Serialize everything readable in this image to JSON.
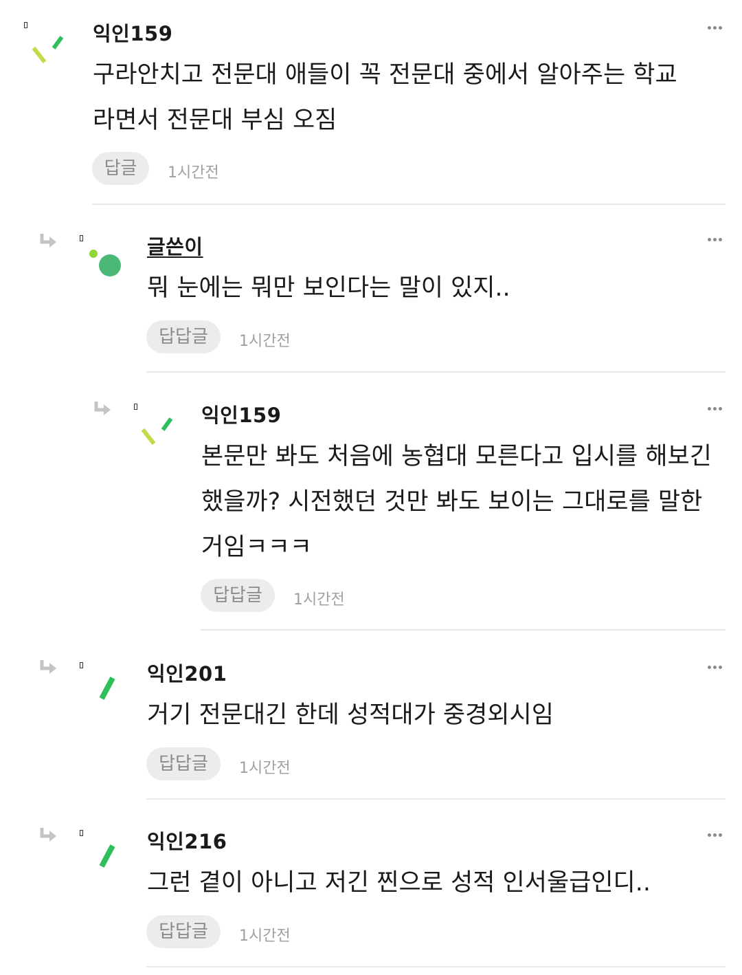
{
  "comments": [
    {
      "author": "익인159",
      "body": "구라안치고 전문대 애들이 꼭 전문대 중에서 알아주는 학교 라면서 전문대 부심 오짐",
      "reply_label": "답글",
      "time": "1시간전"
    },
    {
      "author": "글쓴이",
      "body": "뭐 눈에는 뭐만 보인다는 말이 있지..",
      "reply_label": "답답글",
      "time": "1시간전"
    },
    {
      "author": "익인159",
      "body": "본문만 봐도 처음에 농협대 모른다고 입시를 해보긴 했을까? 시전했던 것만 봐도 보이는 그대로를 말한 거임ㅋㅋㅋ",
      "reply_label": "답답글",
      "time": "1시간전"
    },
    {
      "author": "익인201",
      "body": "거기 전문대긴 한데 성적대가 중경외시임",
      "reply_label": "답답글",
      "time": "1시간전"
    },
    {
      "author": "익인216",
      "body": "그런 곁이 아니고 저긴 찐으로 성적 인서울급인디..",
      "reply_label": "답답글",
      "time": "1시간전"
    }
  ],
  "icons": {
    "reply_arrow": "reply-arrow-icon",
    "more": "more-options-icon"
  },
  "colors": {
    "avatar_yellow_green": "#c6d94a",
    "avatar_green": "#2fbf5a",
    "avatar_op_light": "#8fd63a",
    "avatar_op_dark": "#4cb878",
    "reply_button_bg": "#ececec",
    "muted_text": "#a0a0a0"
  }
}
